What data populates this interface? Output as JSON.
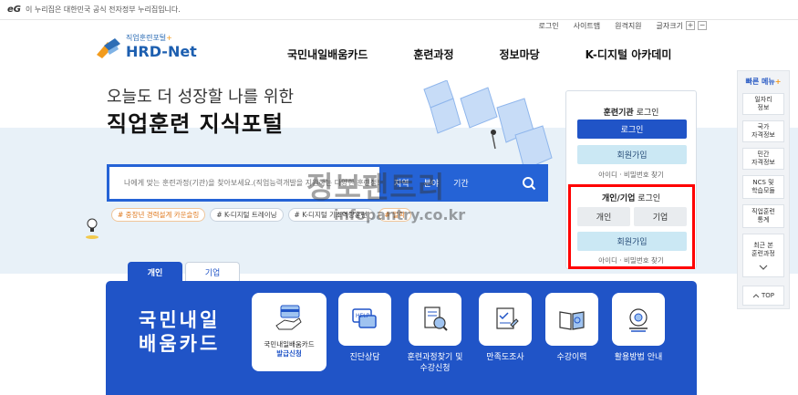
{
  "gov_bar": {
    "logo": "eG",
    "text": "이 누리집은 대한민국 공식 전자정부 누리집입니다."
  },
  "util_links": [
    "로그인",
    "사이트맵",
    "원격지원"
  ],
  "font_size": {
    "label": "글자크기",
    "plus": "+",
    "minus": "−"
  },
  "logo": {
    "small": "직업훈련포털",
    "big": "HRD",
    "dash": "-Net",
    "plus": "+"
  },
  "gnb": [
    "국민내일배움카드",
    "훈련과정",
    "정보마당",
    "K-디지털 아카데미"
  ],
  "hero": {
    "subtitle": "오늘도 더 성장할 나를 위한",
    "title": "직업훈련 지식포털"
  },
  "search": {
    "placeholder": "나에게 맞는 훈련과정(기관)을 찾아보세요.(직업능력개발을 지원하는 다양한 훈련정보를 제공합니다.)",
    "tabs": [
      "지역",
      "분야",
      "기간"
    ]
  },
  "tags": [
    "# 중장년 경력설계 카운슬링",
    "# K-디지털 트레이닝",
    "# K-디지털 기초역량훈련",
    "# 일학"
  ],
  "login_box": {
    "institution": {
      "title_bold": "훈련기관",
      "title_rest": " 로그인",
      "login": "로그인",
      "signup": "회원가입",
      "find": "아이디 · 비밀번호 찾기"
    },
    "personal": {
      "title_bold": "개인/기업",
      "title_rest": " 로그인",
      "personal": "개인",
      "corporate": "기업",
      "signup": "회원가입",
      "find": "아이디 · 비밀번호 찾기"
    }
  },
  "quick_menu": {
    "title": "빠른 메뉴",
    "title_plus": "+",
    "items": [
      "일자리\n정보",
      "국가\n자격정보",
      "민간\n자격정보",
      "NCS 및\n학습모듈",
      "직업훈련\n통계",
      "최근 본\n훈련과정"
    ],
    "top": "TOP"
  },
  "tabs": [
    "개인",
    "기업"
  ],
  "card_panel": {
    "title_line1": "국민내일",
    "title_line2": "배움카드",
    "card_apply": {
      "line1": "국민내일배움카드",
      "line2": "발급신청"
    },
    "features": [
      "진단상담",
      "훈련과정찾기 및\n수강신청",
      "만족도조사",
      "수강이력",
      "활용방법 안내"
    ]
  },
  "watermark": {
    "line1": "정보팬트리",
    "line2": "infopantry.co.kr"
  },
  "colors": {
    "primary": "#2054c7",
    "accent": "#f29b1d",
    "highlight": "#ff0000"
  }
}
